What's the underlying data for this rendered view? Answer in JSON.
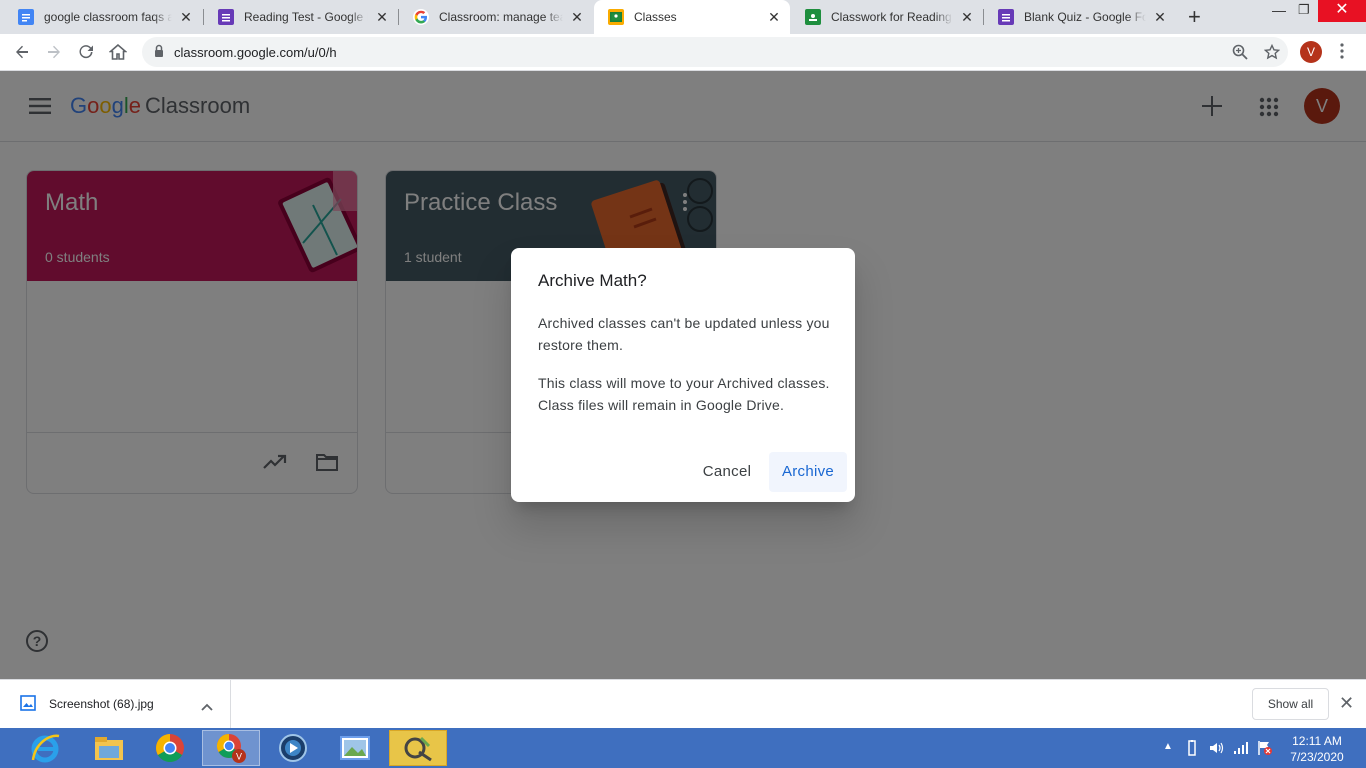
{
  "browser": {
    "tabs": [
      {
        "label": "google classroom faqs a",
        "favicon": "google-docs-icon"
      },
      {
        "label": "Reading Test - Google Fo",
        "favicon": "google-forms-icon"
      },
      {
        "label": "Classroom: manage teac",
        "favicon": "google-g-icon"
      },
      {
        "label": "Classes",
        "favicon": "classroom-icon",
        "active": true
      },
      {
        "label": "Classwork for Reading 1",
        "favicon": "classroom-green-icon"
      },
      {
        "label": "Blank Quiz - Google For",
        "favicon": "google-forms-icon"
      }
    ],
    "url": "classroom.google.com/u/0/h",
    "profile_initial": "V"
  },
  "app": {
    "logo_google": [
      "G",
      "o",
      "o",
      "g",
      "l",
      "e"
    ],
    "logo_product": "Classroom",
    "avatar_initial": "V"
  },
  "classes": [
    {
      "title": "Math",
      "students": "0 students",
      "color": "#c2185b"
    },
    {
      "title": "Practice Class",
      "students": "1 student",
      "color": "#455a64"
    }
  ],
  "dialog": {
    "title": "Archive Math?",
    "paragraph1": "Archived classes can't be updated unless you restore them.",
    "paragraph2": "This class will move to your Archived classes. Class files will remain in Google Drive.",
    "cancel_label": "Cancel",
    "archive_label": "Archive"
  },
  "download_bar": {
    "file_name": "Screenshot (68).jpg",
    "show_all_label": "Show all"
  },
  "taskbar": {
    "time": "12:11 AM",
    "date": "7/23/2020"
  }
}
